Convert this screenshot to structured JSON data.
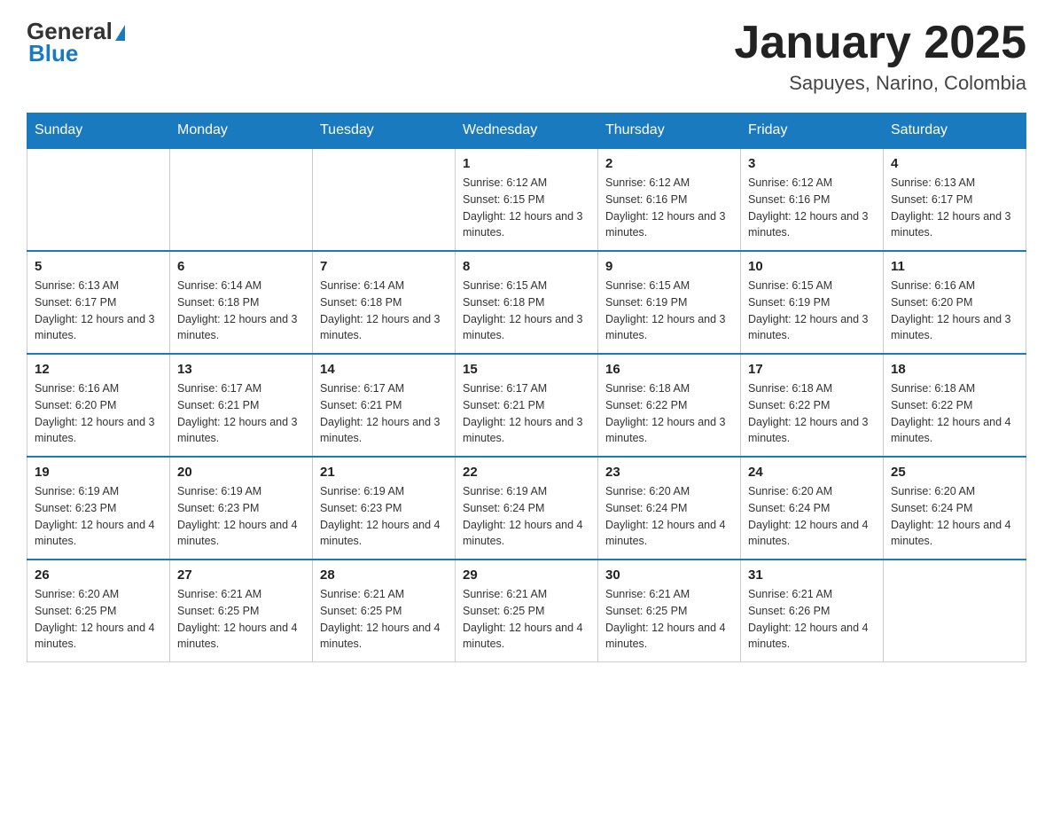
{
  "header": {
    "logo_general": "General",
    "logo_blue": "Blue",
    "month_title": "January 2025",
    "location": "Sapuyes, Narino, Colombia"
  },
  "days_of_week": [
    "Sunday",
    "Monday",
    "Tuesday",
    "Wednesday",
    "Thursday",
    "Friday",
    "Saturday"
  ],
  "weeks": [
    [
      {
        "day": "",
        "sunrise": "",
        "sunset": "",
        "daylight": ""
      },
      {
        "day": "",
        "sunrise": "",
        "sunset": "",
        "daylight": ""
      },
      {
        "day": "",
        "sunrise": "",
        "sunset": "",
        "daylight": ""
      },
      {
        "day": "1",
        "sunrise": "Sunrise: 6:12 AM",
        "sunset": "Sunset: 6:15 PM",
        "daylight": "Daylight: 12 hours and 3 minutes."
      },
      {
        "day": "2",
        "sunrise": "Sunrise: 6:12 AM",
        "sunset": "Sunset: 6:16 PM",
        "daylight": "Daylight: 12 hours and 3 minutes."
      },
      {
        "day": "3",
        "sunrise": "Sunrise: 6:12 AM",
        "sunset": "Sunset: 6:16 PM",
        "daylight": "Daylight: 12 hours and 3 minutes."
      },
      {
        "day": "4",
        "sunrise": "Sunrise: 6:13 AM",
        "sunset": "Sunset: 6:17 PM",
        "daylight": "Daylight: 12 hours and 3 minutes."
      }
    ],
    [
      {
        "day": "5",
        "sunrise": "Sunrise: 6:13 AM",
        "sunset": "Sunset: 6:17 PM",
        "daylight": "Daylight: 12 hours and 3 minutes."
      },
      {
        "day": "6",
        "sunrise": "Sunrise: 6:14 AM",
        "sunset": "Sunset: 6:18 PM",
        "daylight": "Daylight: 12 hours and 3 minutes."
      },
      {
        "day": "7",
        "sunrise": "Sunrise: 6:14 AM",
        "sunset": "Sunset: 6:18 PM",
        "daylight": "Daylight: 12 hours and 3 minutes."
      },
      {
        "day": "8",
        "sunrise": "Sunrise: 6:15 AM",
        "sunset": "Sunset: 6:18 PM",
        "daylight": "Daylight: 12 hours and 3 minutes."
      },
      {
        "day": "9",
        "sunrise": "Sunrise: 6:15 AM",
        "sunset": "Sunset: 6:19 PM",
        "daylight": "Daylight: 12 hours and 3 minutes."
      },
      {
        "day": "10",
        "sunrise": "Sunrise: 6:15 AM",
        "sunset": "Sunset: 6:19 PM",
        "daylight": "Daylight: 12 hours and 3 minutes."
      },
      {
        "day": "11",
        "sunrise": "Sunrise: 6:16 AM",
        "sunset": "Sunset: 6:20 PM",
        "daylight": "Daylight: 12 hours and 3 minutes."
      }
    ],
    [
      {
        "day": "12",
        "sunrise": "Sunrise: 6:16 AM",
        "sunset": "Sunset: 6:20 PM",
        "daylight": "Daylight: 12 hours and 3 minutes."
      },
      {
        "day": "13",
        "sunrise": "Sunrise: 6:17 AM",
        "sunset": "Sunset: 6:21 PM",
        "daylight": "Daylight: 12 hours and 3 minutes."
      },
      {
        "day": "14",
        "sunrise": "Sunrise: 6:17 AM",
        "sunset": "Sunset: 6:21 PM",
        "daylight": "Daylight: 12 hours and 3 minutes."
      },
      {
        "day": "15",
        "sunrise": "Sunrise: 6:17 AM",
        "sunset": "Sunset: 6:21 PM",
        "daylight": "Daylight: 12 hours and 3 minutes."
      },
      {
        "day": "16",
        "sunrise": "Sunrise: 6:18 AM",
        "sunset": "Sunset: 6:22 PM",
        "daylight": "Daylight: 12 hours and 3 minutes."
      },
      {
        "day": "17",
        "sunrise": "Sunrise: 6:18 AM",
        "sunset": "Sunset: 6:22 PM",
        "daylight": "Daylight: 12 hours and 3 minutes."
      },
      {
        "day": "18",
        "sunrise": "Sunrise: 6:18 AM",
        "sunset": "Sunset: 6:22 PM",
        "daylight": "Daylight: 12 hours and 4 minutes."
      }
    ],
    [
      {
        "day": "19",
        "sunrise": "Sunrise: 6:19 AM",
        "sunset": "Sunset: 6:23 PM",
        "daylight": "Daylight: 12 hours and 4 minutes."
      },
      {
        "day": "20",
        "sunrise": "Sunrise: 6:19 AM",
        "sunset": "Sunset: 6:23 PM",
        "daylight": "Daylight: 12 hours and 4 minutes."
      },
      {
        "day": "21",
        "sunrise": "Sunrise: 6:19 AM",
        "sunset": "Sunset: 6:23 PM",
        "daylight": "Daylight: 12 hours and 4 minutes."
      },
      {
        "day": "22",
        "sunrise": "Sunrise: 6:19 AM",
        "sunset": "Sunset: 6:24 PM",
        "daylight": "Daylight: 12 hours and 4 minutes."
      },
      {
        "day": "23",
        "sunrise": "Sunrise: 6:20 AM",
        "sunset": "Sunset: 6:24 PM",
        "daylight": "Daylight: 12 hours and 4 minutes."
      },
      {
        "day": "24",
        "sunrise": "Sunrise: 6:20 AM",
        "sunset": "Sunset: 6:24 PM",
        "daylight": "Daylight: 12 hours and 4 minutes."
      },
      {
        "day": "25",
        "sunrise": "Sunrise: 6:20 AM",
        "sunset": "Sunset: 6:24 PM",
        "daylight": "Daylight: 12 hours and 4 minutes."
      }
    ],
    [
      {
        "day": "26",
        "sunrise": "Sunrise: 6:20 AM",
        "sunset": "Sunset: 6:25 PM",
        "daylight": "Daylight: 12 hours and 4 minutes."
      },
      {
        "day": "27",
        "sunrise": "Sunrise: 6:21 AM",
        "sunset": "Sunset: 6:25 PM",
        "daylight": "Daylight: 12 hours and 4 minutes."
      },
      {
        "day": "28",
        "sunrise": "Sunrise: 6:21 AM",
        "sunset": "Sunset: 6:25 PM",
        "daylight": "Daylight: 12 hours and 4 minutes."
      },
      {
        "day": "29",
        "sunrise": "Sunrise: 6:21 AM",
        "sunset": "Sunset: 6:25 PM",
        "daylight": "Daylight: 12 hours and 4 minutes."
      },
      {
        "day": "30",
        "sunrise": "Sunrise: 6:21 AM",
        "sunset": "Sunset: 6:25 PM",
        "daylight": "Daylight: 12 hours and 4 minutes."
      },
      {
        "day": "31",
        "sunrise": "Sunrise: 6:21 AM",
        "sunset": "Sunset: 6:26 PM",
        "daylight": "Daylight: 12 hours and 4 minutes."
      },
      {
        "day": "",
        "sunrise": "",
        "sunset": "",
        "daylight": ""
      }
    ]
  ]
}
